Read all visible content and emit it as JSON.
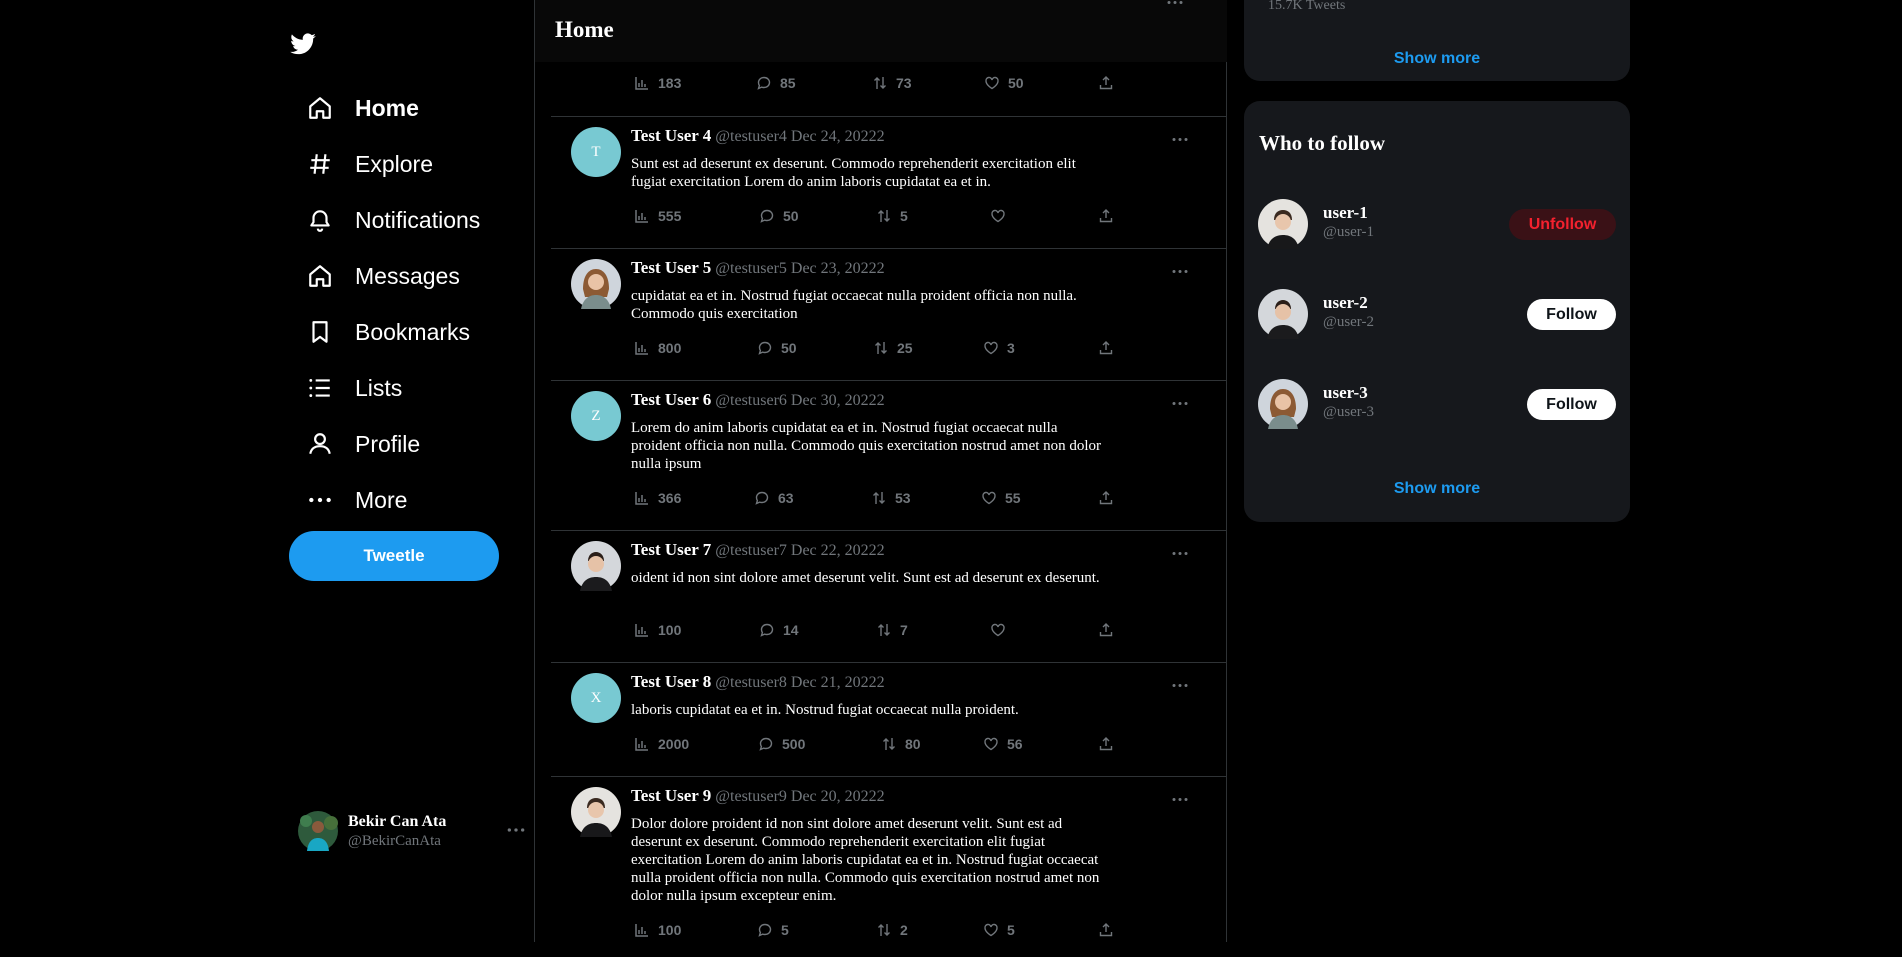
{
  "sidebar": {
    "logo": "twitter-bird-icon",
    "nav": [
      {
        "label": "Home",
        "icon": "home-icon",
        "active": true
      },
      {
        "label": "Explore",
        "icon": "hashtag-icon"
      },
      {
        "label": "Notifications",
        "icon": "bell-icon"
      },
      {
        "label": "Messages",
        "icon": "home-icon"
      },
      {
        "label": "Bookmarks",
        "icon": "bookmark-icon"
      },
      {
        "label": "Lists",
        "icon": "list-icon"
      },
      {
        "label": "Profile",
        "icon": "user-icon"
      },
      {
        "label": "More",
        "icon": "more-icon"
      }
    ],
    "tweet_button": "Tweetle",
    "account": {
      "name": "Bekir Can Ata",
      "handle": "@BekirCanAta"
    }
  },
  "main": {
    "title": "Home",
    "top_stats": {
      "views": "183",
      "replies": "85",
      "retweets": "73",
      "likes": "50"
    },
    "tweets": [
      {
        "name": "Test User 4",
        "handle": "@testuser4",
        "date": "Dec 24, 20222",
        "avatar_letter": "T",
        "text": "Sunt est ad deserunt ex deserunt. Commodo reprehenderit exercitation elit fugiat exercitation Lorem do anim laboris cupidatat ea et in.",
        "views": "555",
        "replies": "50",
        "retweets": "5",
        "likes": ""
      },
      {
        "name": "Test User 5",
        "handle": "@testuser5",
        "date": "Dec 23, 20222",
        "avatar_letter": "",
        "text": "cupidatat ea et in. Nostrud fugiat occaecat nulla proident officia non nulla. Commodo quis exercitation",
        "views": "800",
        "replies": "50",
        "retweets": "25",
        "likes": "3"
      },
      {
        "name": "Test User 6",
        "handle": "@testuser6",
        "date": "Dec 30, 20222",
        "avatar_letter": "Z",
        "text": "Lorem do anim laboris cupidatat ea et in. Nostrud fugiat occaecat nulla proident officia non nulla. Commodo quis exercitation nostrud amet non dolor nulla ipsum",
        "views": "366",
        "replies": "63",
        "retweets": "53",
        "likes": "55"
      },
      {
        "name": "Test User 7",
        "handle": "@testuser7",
        "date": "Dec 22, 20222",
        "avatar_letter": "",
        "text": "oident id non sint dolore amet deserunt velit. Sunt est ad deserunt ex deserunt.",
        "views": "100",
        "replies": "14",
        "retweets": "7",
        "likes": ""
      },
      {
        "name": "Test User 8",
        "handle": "@testuser8",
        "date": "Dec 21, 20222",
        "avatar_letter": "X",
        "text": "laboris cupidatat ea et in. Nostrud fugiat occaecat nulla proident.",
        "views": "2000",
        "replies": "500",
        "retweets": "80",
        "likes": "56"
      },
      {
        "name": "Test User 9",
        "handle": "@testuser9",
        "date": "Dec 20, 20222",
        "avatar_letter": "",
        "text": "Dolor dolore proident id non sint dolore amet deserunt velit. Sunt est ad deserunt ex deserunt. Commodo reprehenderit exercitation elit fugiat exercitation Lorem do anim laboris cupidatat ea et in. Nostrud fugiat occaecat nulla proident officia non nulla. Commodo quis exercitation nostrud amet non dolor nulla ipsum excepteur enim.",
        "views": "100",
        "replies": "5",
        "retweets": "2",
        "likes": "5"
      }
    ]
  },
  "right": {
    "trends_card": {
      "tweet_count": "15.7K Tweets",
      "show_more": "Show more"
    },
    "who_to_follow": {
      "title": "Who to follow",
      "users": [
        {
          "name": "user-1",
          "handle": "@user-1",
          "button": "Unfollow"
        },
        {
          "name": "user-2",
          "handle": "@user-2",
          "button": "Follow"
        },
        {
          "name": "user-3",
          "handle": "@user-3",
          "button": "Follow"
        }
      ],
      "show_more": "Show more"
    }
  },
  "colors": {
    "accent": "#1d9bf0",
    "background": "#000000",
    "card": "#16181c",
    "muted": "#71767b",
    "unfollow": "#f4212e"
  }
}
